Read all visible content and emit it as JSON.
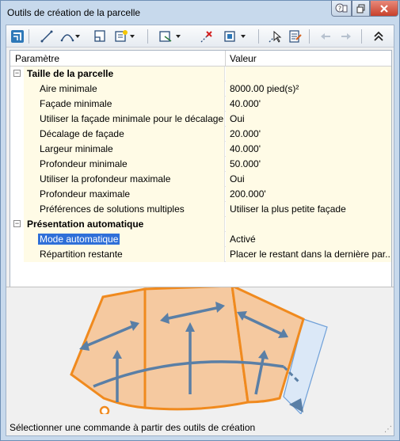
{
  "window": {
    "title": "Outils de création de la parcelle"
  },
  "toolbar": {
    "icons": [
      "parcel-layout-icon",
      "line-tool-icon",
      "curve-tool-icon",
      "freeform-tool-icon",
      "slide-line-icon",
      "swing-line-icon",
      "delete-sub-entity-icon",
      "parcel-union-icon",
      "pick-sub-entity-icon",
      "sub-entity-editor-icon",
      "undo-icon",
      "redo-icon",
      "collapse-icon"
    ]
  },
  "grid": {
    "columns": {
      "param": "Paramètre",
      "value": "Valeur"
    },
    "categories": [
      {
        "label": "Taille de la parcelle",
        "rows": [
          {
            "name": "Aire minimale",
            "value": "8000.00 pied(s)²"
          },
          {
            "name": "Façade minimale",
            "value": "40.000'"
          },
          {
            "name": "Utiliser la façade minimale pour le décalage",
            "value": "Oui"
          },
          {
            "name": "Décalage de façade",
            "value": "20.000'"
          },
          {
            "name": "Largeur minimale",
            "value": "40.000'"
          },
          {
            "name": "Profondeur minimale",
            "value": "50.000'"
          },
          {
            "name": "Utiliser la profondeur maximale",
            "value": "Oui"
          },
          {
            "name": "Profondeur maximale",
            "value": "200.000'"
          },
          {
            "name": "Préférences de solutions multiples",
            "value": "Utiliser la plus petite façade"
          }
        ]
      },
      {
        "label": "Présentation automatique",
        "rows": [
          {
            "name": "Mode automatique",
            "value": "Activé"
          },
          {
            "name": "Répartition restante",
            "value": "Placer le restant dans la dernière par..."
          }
        ]
      }
    ]
  },
  "status": {
    "text": "Sélectionner une commande à partir des outils de création"
  },
  "colors": {
    "parcel_fill": "#f5c9a0",
    "parcel_stroke": "#f08a1e",
    "remainder_fill": "#dbe8f7",
    "arrow": "#5a7fa6",
    "selection": "#2f6fd8"
  }
}
